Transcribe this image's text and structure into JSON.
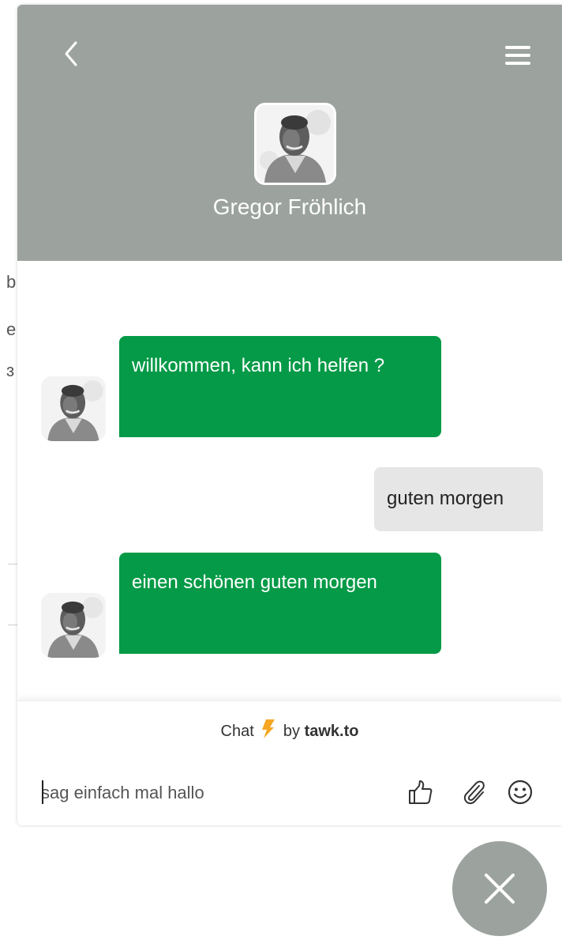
{
  "header": {
    "agent_name": "Gregor Fröhlich"
  },
  "messages": [
    {
      "from": "agent",
      "text": "willkommen, kann ich helfen ?"
    },
    {
      "from": "visitor",
      "text": "guten morgen"
    },
    {
      "from": "agent",
      "text": "einen schönen guten morgen"
    }
  ],
  "footer": {
    "branding_prefix": "Chat",
    "branding_by": "by",
    "branding_brand": "tawk.to",
    "input_placeholder": "sag einfach mal hallo"
  },
  "background_page": {
    "fragments": [
      "b",
      "e",
      "ɜ"
    ]
  },
  "colors": {
    "header_bg": "#9ca39e",
    "agent_bubble": "#049a47",
    "visitor_bubble": "#e6e6e6",
    "bolt": "#f5a623"
  },
  "icons": {
    "back": "chevron-left-icon",
    "menu": "hamburger-menu-icon",
    "thumbs_up": "thumbs-up-icon",
    "attach": "paperclip-icon",
    "emoji": "smiley-icon",
    "close": "close-icon",
    "branding": "lightning-bolt-icon"
  }
}
